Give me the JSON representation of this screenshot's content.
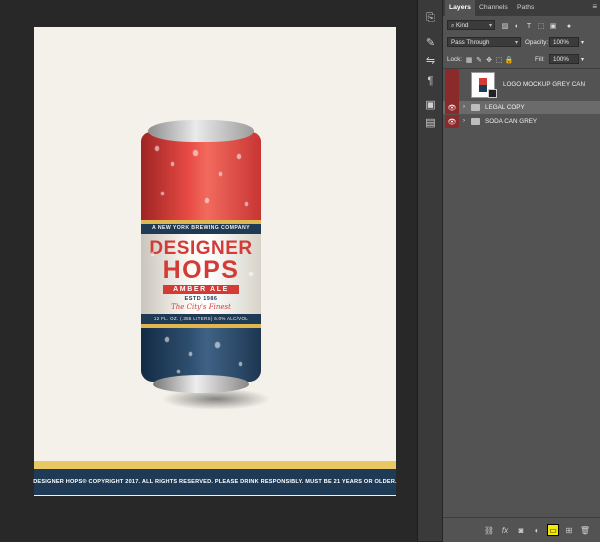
{
  "document": {
    "footer_text": "DESIGNER HOPS® COPYRIGHT 2017. ALL RIGHTS RESERVED. PLEASE DRINK RESPONSIBLY. MUST BE 21 YEARS OR OLDER.",
    "can": {
      "brand_line": "A NEW YORK BREWING COMPANY",
      "title_line1": "DESIGNER",
      "title_line2": "HOPS",
      "subtitle": "AMBER ALE",
      "established": "ESTD 1986",
      "slogan": "The City's Finest",
      "legal_line": "12 FL. OZ. (.355 LITERS) 6.0% ALC/VOL"
    }
  },
  "panel": {
    "tabs": [
      "Layers",
      "Channels",
      "Paths"
    ],
    "filter": {
      "label": "Kind",
      "icon": "search-icon"
    },
    "blend_mode": "Pass Through",
    "opacity": {
      "label": "Opacity:",
      "value": "100%"
    },
    "lock": {
      "label": "Lock:"
    },
    "fill": {
      "label": "Fill:",
      "value": "100%"
    },
    "layers": [
      {
        "name": "LOGO MOCKUP GREY CAN",
        "type": "smart-object"
      },
      {
        "name": "LEGAL COPY",
        "type": "group",
        "selected": true
      },
      {
        "name": "SODA CAN GREY",
        "type": "group"
      }
    ],
    "bottom_icons": [
      "link-icon",
      "fx-icon",
      "mask-icon",
      "adjustment-icon",
      "new-group-icon",
      "new-layer-icon",
      "trash-icon"
    ],
    "highlighted_icon": "new-group-icon"
  },
  "colors": {
    "accent_highlight": "#f4e900",
    "eye_column": "#8a2a2a",
    "selected_row": "#6b6b6b",
    "can_red": "#d43b36",
    "can_navy": "#1f3a55",
    "can_gold": "#e0b650"
  }
}
